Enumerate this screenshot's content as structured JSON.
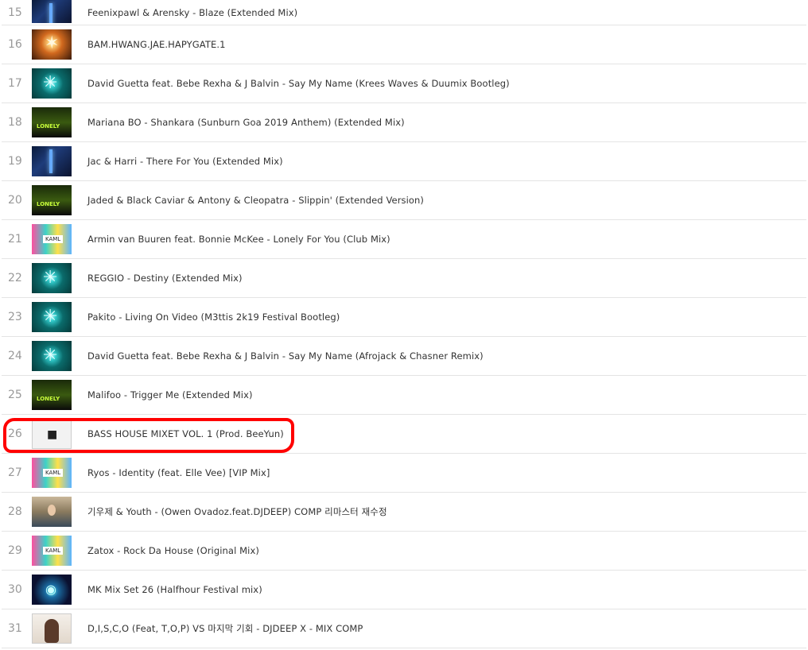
{
  "tracks": [
    {
      "rank": "15",
      "title": "Feenixpawl & Arensky - Blaze (Extended Mix)",
      "art": "blue"
    },
    {
      "rank": "16",
      "title": "BAM.HWANG.JAE.HAPYGATE.1",
      "art": "orange"
    },
    {
      "rank": "17",
      "title": "David Guetta feat. Bebe Rexha & J Balvin - Say My Name (Krees Waves & Duumix Bootleg)",
      "art": "teal"
    },
    {
      "rank": "18",
      "title": "Mariana BO - Shankara (Sunburn Goa 2019 Anthem) (Extended Mix)",
      "art": "green"
    },
    {
      "rank": "19",
      "title": "Jac & Harri - There For You (Extended Mix)",
      "art": "blue"
    },
    {
      "rank": "20",
      "title": "Jaded & Black Caviar & Antony & Cleopatra - Slippin' (Extended Version)",
      "art": "green"
    },
    {
      "rank": "21",
      "title": "Armin van Buuren feat. Bonnie McKee - Lonely For You (Club Mix)",
      "art": "pop"
    },
    {
      "rank": "22",
      "title": "REGGIO - Destiny (Extended Mix)",
      "art": "teal"
    },
    {
      "rank": "23",
      "title": "Pakito - Living On Video (M3ttis 2k19 Festival Bootleg)",
      "art": "teal"
    },
    {
      "rank": "24",
      "title": "David Guetta feat. Bebe Rexha & J Balvin - Say My Name (Afrojack & Chasner Remix)",
      "art": "teal"
    },
    {
      "rank": "25",
      "title": "Malifoo - Trigger Me (Extended Mix)",
      "art": "green"
    },
    {
      "rank": "26",
      "title": "BASS HOUSE MIXET VOL. 1 (Prod. BeeYun)",
      "art": "white"
    },
    {
      "rank": "27",
      "title": "Ryos - Identity (feat. Elle Vee) [VIP Mix]",
      "art": "pop"
    },
    {
      "rank": "28",
      "title": "기우제 & Youth - (Owen Ovadoz.feat.DJDEEP) COMP 리마스터 재수정",
      "art": "photo"
    },
    {
      "rank": "29",
      "title": "Zatox - Rock Da House (Original Mix)",
      "art": "pop"
    },
    {
      "rank": "30",
      "title": "MK Mix Set 26 (Halfhour Festival mix)",
      "art": "eye"
    },
    {
      "rank": "31",
      "title": "D,I,S,C,O (Feat, T,O,P) VS 마지막 기회 - DJDEEP X - MIX COMP",
      "art": "portrait"
    }
  ],
  "annotation": {
    "color": "#ff0000",
    "highlighted_rank": "26"
  }
}
